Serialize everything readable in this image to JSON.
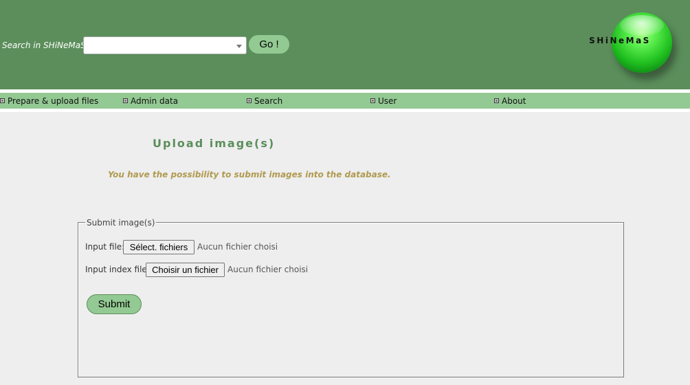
{
  "header": {
    "search_label": "Search in SHiNeMaS :",
    "search_value": "",
    "go_label": "Go !",
    "logo_text": "SHiNeMaS"
  },
  "nav": {
    "items": [
      {
        "label": "Prepare & upload files"
      },
      {
        "label": "Admin data"
      },
      {
        "label": "Search"
      },
      {
        "label": "User"
      },
      {
        "label": "About"
      }
    ]
  },
  "main": {
    "title": "Upload image(s)",
    "intro": "You have the possibility to submit images into the database.",
    "form": {
      "legend": "Submit image(s)",
      "input_file": {
        "label": "Input file:",
        "button": "Sélect. fichiers",
        "status": "Aucun fichier choisi"
      },
      "index_file": {
        "label": "Input index file:",
        "button": "Choisir un fichier",
        "status": "Aucun fichier choisi"
      },
      "submit_label": "Submit"
    }
  },
  "colors": {
    "header_bg": "#5b8e5b",
    "nav_bg": "#93c993",
    "button_bg": "#93c993",
    "title": "#5b8e5b",
    "intro": "#b09a50",
    "page_bg": "#eeeeee"
  },
  "icons": {
    "nav_bullet": "square-bullet-icon",
    "select_arrow": "chevron-down-icon",
    "logo": "green-sphere-logo"
  }
}
